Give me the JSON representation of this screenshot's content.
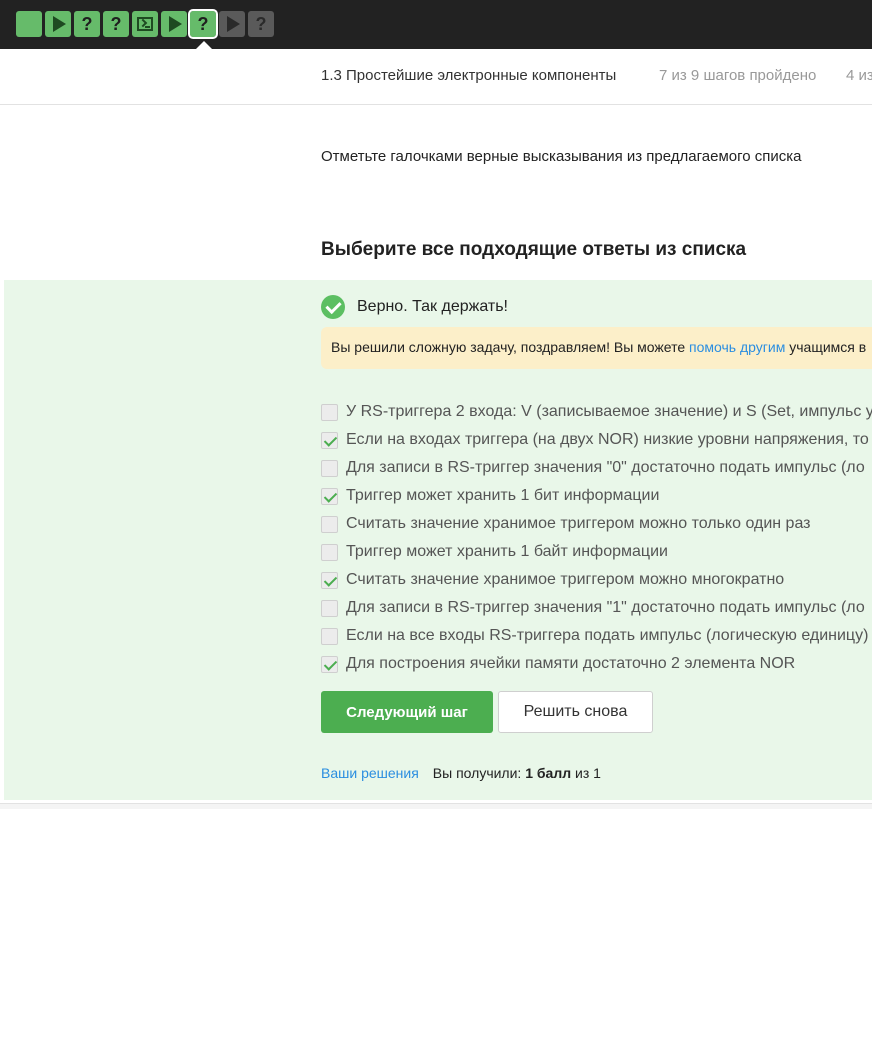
{
  "step_nav": {
    "steps": [
      {
        "type": "text",
        "state": "done"
      },
      {
        "type": "video",
        "state": "done"
      },
      {
        "type": "quiz",
        "state": "done",
        "glyph": "?"
      },
      {
        "type": "quiz",
        "state": "done",
        "glyph": "?"
      },
      {
        "type": "code",
        "state": "done"
      },
      {
        "type": "video",
        "state": "done"
      },
      {
        "type": "quiz",
        "state": "done-active",
        "glyph": "?"
      },
      {
        "type": "video",
        "state": "todo"
      },
      {
        "type": "quiz",
        "state": "todo",
        "glyph": "?"
      }
    ]
  },
  "lesson": {
    "title": "1.3 Простейшие электронные компоненты",
    "progress": "7 из 9 шагов пройдено",
    "extra": "4 из"
  },
  "task": {
    "text": "Отметьте галочками верные высказывания из предлагаемого списка",
    "heading": "Выберите все подходящие ответы из списка"
  },
  "result": {
    "text": "Верно. Так держать!",
    "notice_before": "Вы решили сложную задачу, поздравляем! Вы можете ",
    "notice_link": "помочь другим",
    "notice_after": " учащимся в"
  },
  "options": [
    {
      "label": "У RS-триггера 2 входа: V (записываемое значение) и S (Set, импульс ус",
      "checked": false
    },
    {
      "label": "Если на входах триггера (на двух NOR) низкие уровни напряжения, то",
      "checked": true
    },
    {
      "label": "Для записи в RS-триггер значения \"0\" достаточно подать импульс (ло",
      "checked": false
    },
    {
      "label": "Триггер может хранить 1 бит информации",
      "checked": true
    },
    {
      "label": "Считать значение хранимое триггером можно только один раз",
      "checked": false
    },
    {
      "label": "Триггер может хранить 1 байт информации",
      "checked": false
    },
    {
      "label": "Считать значение хранимое триггером можно многократно",
      "checked": true
    },
    {
      "label": "Для записи в RS-триггер значения \"1\" достаточно подать импульс (ло",
      "checked": false
    },
    {
      "label": "Если на все входы RS-триггера подать импульс (логическую единицу)",
      "checked": false
    },
    {
      "label": "Для построения ячейки памяти достаточно 2 элемента NOR",
      "checked": true
    }
  ],
  "buttons": {
    "next": "Следующий шаг",
    "retry": "Решить снова"
  },
  "footer": {
    "solutions_link": "Ваши решения",
    "score_prefix": "Вы получили: ",
    "score_value": "1 балл",
    "score_suffix": " из 1"
  },
  "colors": {
    "accent_green": "#4cae50",
    "panel_bg": "#e9f7e9",
    "notice_bg": "#fcefc9",
    "link_blue": "#2b8ee0",
    "topbar": "#222222"
  }
}
